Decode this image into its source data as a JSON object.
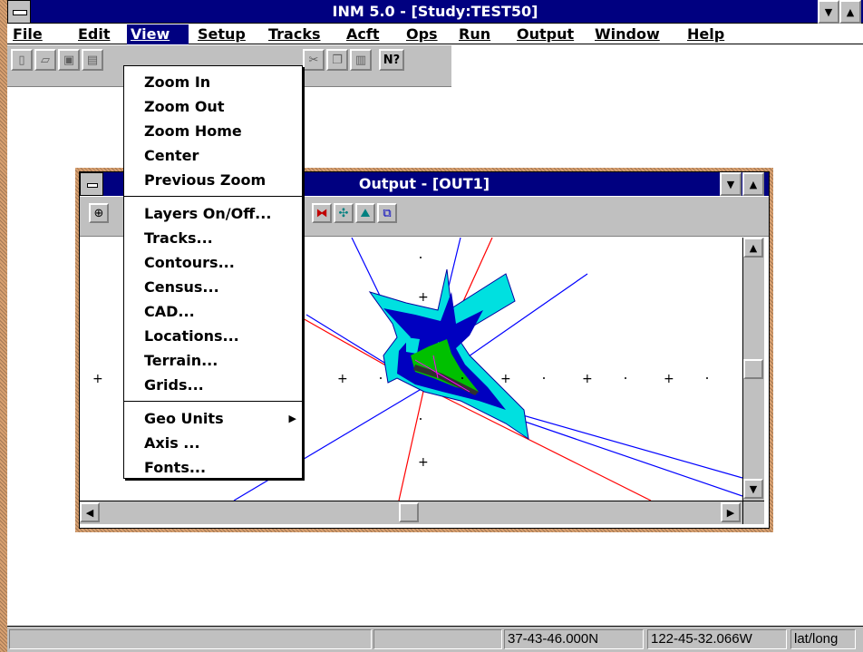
{
  "app": {
    "title": "INM 5.0 - [Study:TEST50]",
    "min_glyph": "▼",
    "max_glyph": "▲"
  },
  "menubar": {
    "items": [
      {
        "label": "File"
      },
      {
        "label": "Edit"
      },
      {
        "label": "View"
      },
      {
        "label": "Setup"
      },
      {
        "label": "Tracks"
      },
      {
        "label": "Acft"
      },
      {
        "label": "Ops"
      },
      {
        "label": "Run"
      },
      {
        "label": "Output"
      },
      {
        "label": "Window"
      },
      {
        "label": "Help"
      }
    ]
  },
  "view_menu": {
    "group1": [
      "Zoom In",
      "Zoom Out",
      "Zoom Home",
      "Center",
      "Previous Zoom"
    ],
    "group2": [
      "Layers On/Off...",
      "Tracks...",
      "Contours...",
      "Census...",
      "CAD...",
      "Locations...",
      "Terrain...",
      "Grids..."
    ],
    "group3": [
      "Geo Units",
      "Axis ...",
      "Fonts..."
    ]
  },
  "toolbar": {
    "help_glyph": "N?"
  },
  "output_window": {
    "title": "Output - [OUT1]",
    "zoom_glyph": "⊕"
  },
  "map": {
    "grid_marker": "+"
  },
  "colors": {
    "title_bar": "#000080",
    "window_frame": "#e8743a",
    "contour_outer": "#00e0e0",
    "contour_mid": "#0000c0",
    "contour_inner": "#00c000",
    "track_blue": "#0000ff",
    "track_red": "#ff0000"
  },
  "statusbar": {
    "latitude": "37-43-46.000N",
    "longitude": "122-45-32.066W",
    "units": "lat/long"
  }
}
